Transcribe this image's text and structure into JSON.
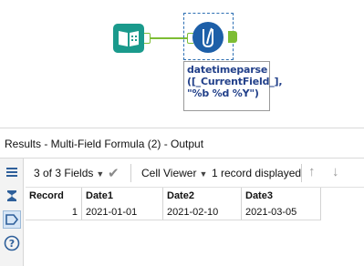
{
  "canvas": {
    "annotation_lines": [
      "datetimeparse",
      "([_CurrentField_],",
      "\"%b %d %Y\")"
    ]
  },
  "results": {
    "title": "Results - Multi-Field Formula (2) - Output",
    "fields_label": "3 of 3 Fields",
    "viewer_label": "Cell Viewer",
    "record_count_label": "1 record displayed",
    "columns": [
      "Record",
      "Date1",
      "Date2",
      "Date3"
    ],
    "rows": [
      [
        "1",
        "2021-01-01",
        "2021-02-10",
        "2021-03-05"
      ]
    ]
  },
  "colors": {
    "accent_green": "#7dbd34",
    "formula_blue": "#1d5fa8",
    "input_teal": "#1a9a8c",
    "annotation_text": "#22408a"
  }
}
